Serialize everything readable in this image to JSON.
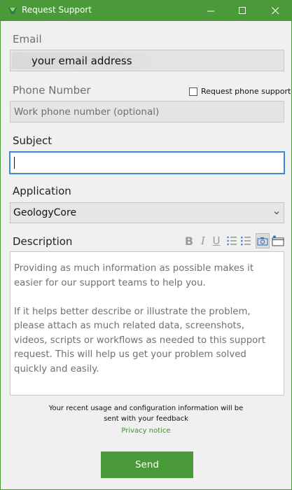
{
  "window": {
    "title": "Request Support",
    "accent_color": "#4a9a3a",
    "controls": [
      "minimize-icon",
      "maximize-icon",
      "close-icon"
    ]
  },
  "email": {
    "label": "Email",
    "value": "your email address"
  },
  "phone": {
    "label": "Phone Number",
    "placeholder": "Work phone number (optional)",
    "request_checkbox_label": "Request phone support",
    "request_checked": false
  },
  "subject": {
    "label": "Subject",
    "value": ""
  },
  "application": {
    "label": "Application",
    "selected": "GeologyCore"
  },
  "description": {
    "label": "Description",
    "toolbar": {
      "bold": "B",
      "italic": "I",
      "underline": "U",
      "icons": [
        "bold-icon",
        "italic-icon",
        "underline-icon",
        "bulleted-list-icon",
        "numbered-list-icon",
        "camera-icon",
        "screenshot-window-icon"
      ]
    },
    "placeholder_paragraph_1": "Providing as much information as possible makes it easier for our support teams to help you.",
    "placeholder_paragraph_2": "If it helps better describe or illustrate the problem, please attach as much related data, screenshots, videos, scripts or workflows as needed to this support request. This will help us get your problem solved quickly and easily."
  },
  "footer": {
    "notice_line_1": "Your recent usage and configuration information will be",
    "notice_line_2": "sent with your feedback",
    "privacy_link": "Privacy notice",
    "send_label": "Send"
  }
}
